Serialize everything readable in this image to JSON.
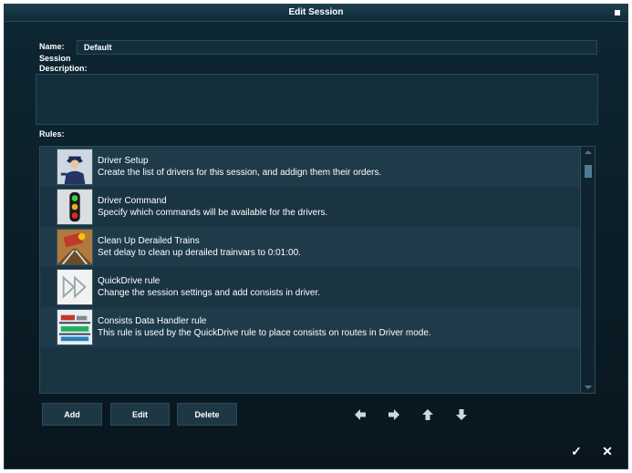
{
  "window": {
    "title": "Edit Session"
  },
  "form": {
    "name_label": "Name:",
    "name_value": "Default",
    "desc_label_line1": "Session",
    "desc_label_line2": "Description:",
    "description_value": "",
    "rules_label": "Rules:"
  },
  "rules": [
    {
      "name": "Driver Setup",
      "description": "Create the list of drivers for this session, and addign them their orders.",
      "icon": "driver-person-icon"
    },
    {
      "name": "Driver Command",
      "description": "Specify which commands will be available for the drivers.",
      "icon": "traffic-signal-icon"
    },
    {
      "name": "Clean Up Derailed Trains",
      "description": "Set delay to clean up derailed trainvars to 0:01:00.",
      "icon": "derailed-train-icon"
    },
    {
      "name": "QuickDrive rule",
      "description": "Change the session settings and add consists in driver.",
      "icon": "fast-forward-icon"
    },
    {
      "name": "Consists Data Handler rule",
      "description": "This rule is used by the QuickDrive rule to place consists on routes in Driver mode.",
      "icon": "consists-train-icon"
    }
  ],
  "buttons": {
    "add": "Add",
    "edit": "Edit",
    "delete": "Delete"
  },
  "icons": {
    "maximize": "maximize-icon",
    "move_left": "arrow-left-icon",
    "move_right": "arrow-right-icon",
    "move_up": "arrow-up-icon",
    "move_down": "arrow-down-icon",
    "ok": "checkmark-icon",
    "close": "close-icon",
    "ok_glyph": "✓",
    "close_glyph": "✕"
  },
  "colors": {
    "background": "#0b1f29",
    "panel": "#1a3442",
    "field": "#142f3c",
    "text": "#ffffff"
  }
}
